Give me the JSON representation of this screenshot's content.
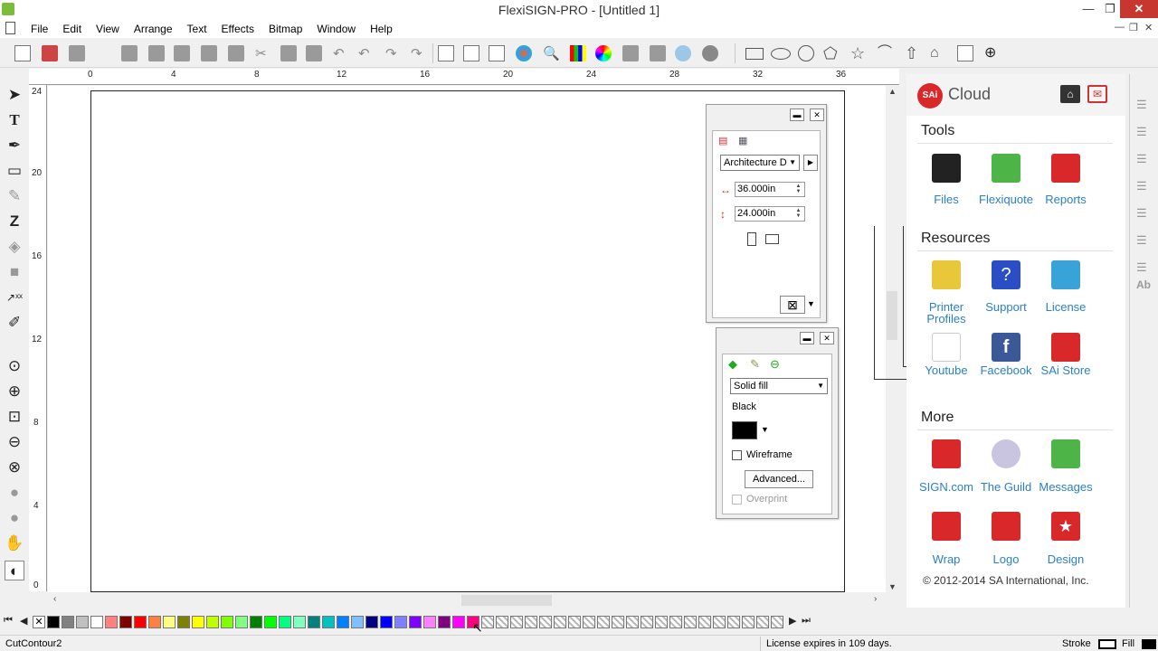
{
  "window": {
    "title": "FlexiSIGN-PRO - [Untitled 1]"
  },
  "menu": [
    "File",
    "Edit",
    "View",
    "Arrange",
    "Text",
    "Effects",
    "Bitmap",
    "Window",
    "Help"
  ],
  "ruler": {
    "units": "inches",
    "top_labels": [
      "0",
      "4",
      "8",
      "12",
      "16",
      "20",
      "24",
      "28",
      "32",
      "36"
    ],
    "left_labels": [
      "24",
      "20",
      "16",
      "12",
      "8",
      "4",
      "0"
    ]
  },
  "page_panel": {
    "preset": "Architecture D",
    "width": "36.000in",
    "height": "24.000in"
  },
  "fill_panel": {
    "fill_type": "Solid fill",
    "color_name": "Black",
    "wireframe_label": "Wireframe",
    "advanced_label": "Advanced...",
    "overprint_label": "Overprint"
  },
  "cloud": {
    "logo_text": "SAi",
    "title": "Cloud",
    "sections": [
      {
        "title": "Tools",
        "items": [
          {
            "label": "Files"
          },
          {
            "label": "Flexiquote"
          },
          {
            "label": "Reports"
          }
        ]
      },
      {
        "title": "Resources",
        "items": [
          {
            "label": "Printer Profiles"
          },
          {
            "label": "Support"
          },
          {
            "label": "License"
          },
          {
            "label": "Youtube"
          },
          {
            "label": "Facebook"
          },
          {
            "label": "SAi Store"
          }
        ]
      },
      {
        "title": "More",
        "items": [
          {
            "label": "SIGN.com"
          },
          {
            "label": "The Guild"
          },
          {
            "label": "Messages"
          },
          {
            "label": "Wrap"
          },
          {
            "label": "Logo"
          },
          {
            "label": "Design"
          }
        ]
      }
    ],
    "copyright": "© 2012-2014 SA International, Inc."
  },
  "status": {
    "left": "CutContour2",
    "license": "License expires in 109 days.",
    "stroke_label": "Stroke",
    "fill_label": "Fill"
  },
  "colors": {
    "accent_red": "#d8282a",
    "link_blue": "#2a7fc5",
    "palette": [
      "#000000",
      "#808080",
      "#c0c0c0",
      "#ffffff",
      "#ff8080",
      "#800000",
      "#ff0000",
      "#ff8040",
      "#ffff80",
      "#808000",
      "#ffff00",
      "#c0ff00",
      "#80ff00",
      "#80ff80",
      "#008000",
      "#00ff00",
      "#00ff80",
      "#80ffc0",
      "#008080",
      "#00c0c0",
      "#0080ff",
      "#80c0ff",
      "#000080",
      "#0000ff",
      "#8080ff",
      "#8000ff",
      "#ff80ff",
      "#800080",
      "#ff00ff",
      "#ff0080"
    ]
  }
}
